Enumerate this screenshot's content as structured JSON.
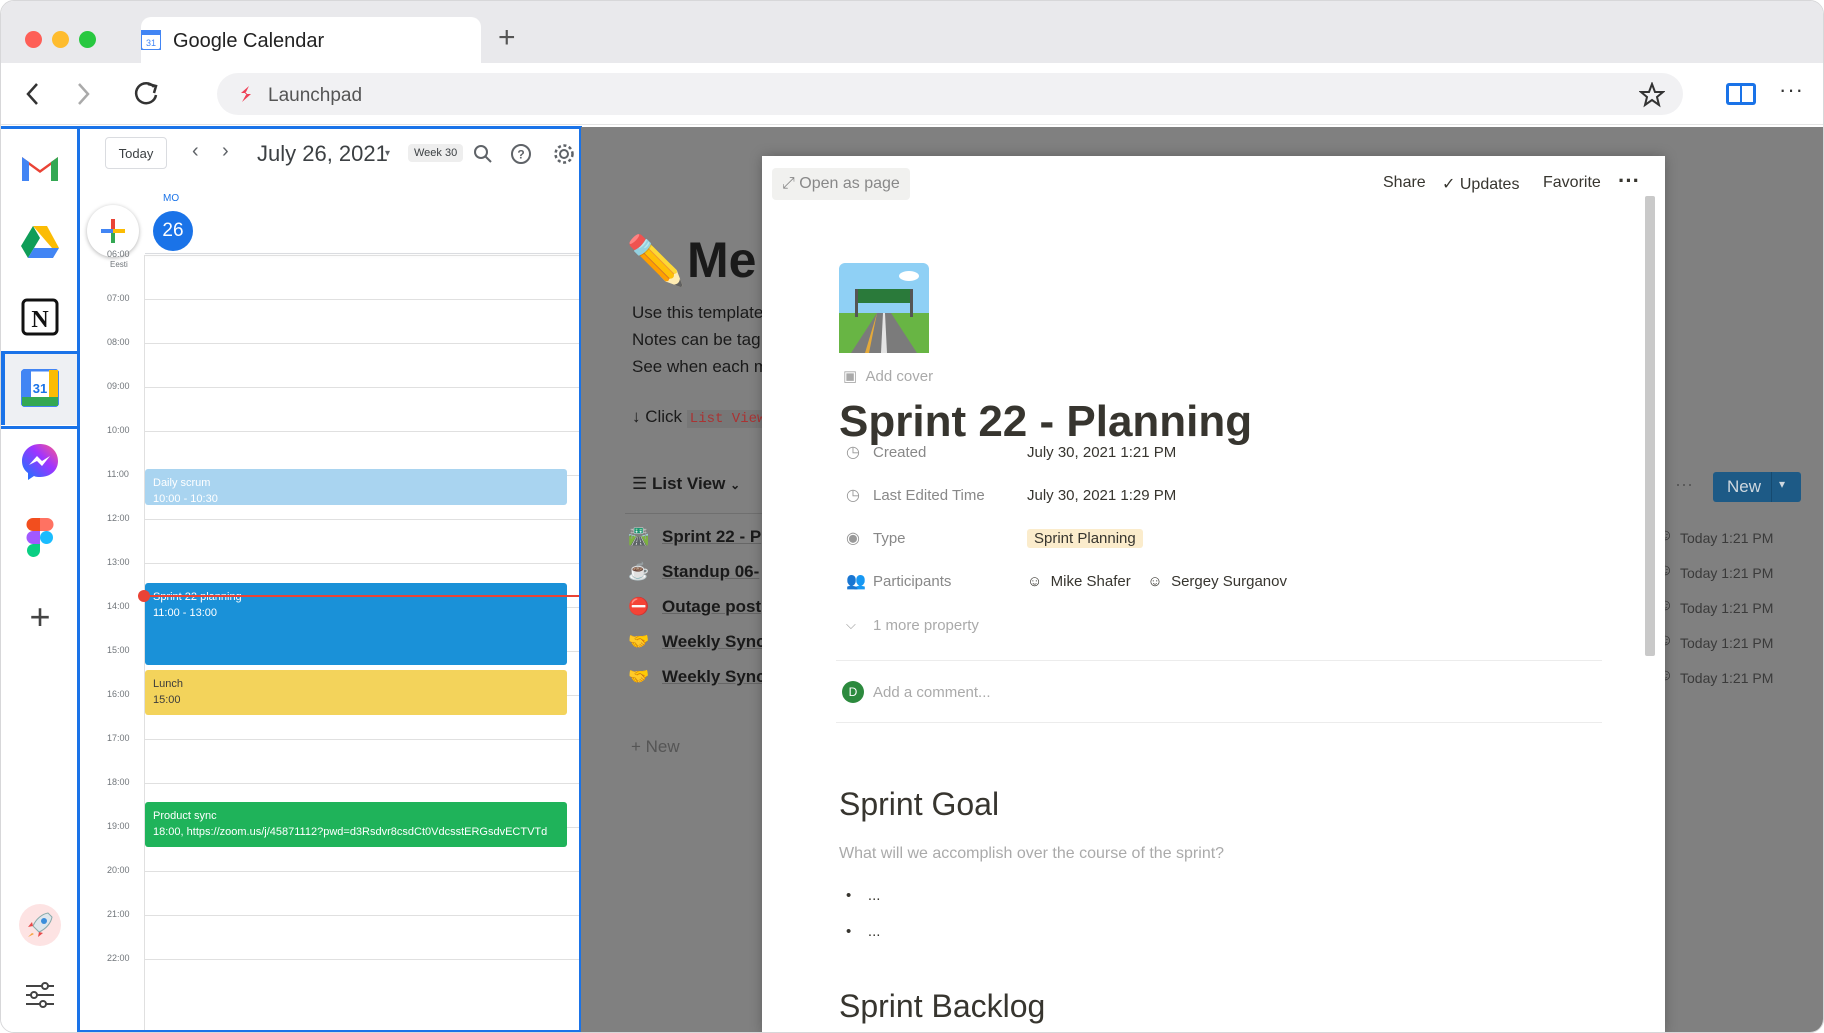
{
  "browser": {
    "tab_title": "Google Calendar",
    "url_text": "Launchpad"
  },
  "sidebar": {
    "apps": [
      "gmail-icon",
      "google-drive-icon",
      "notion-icon",
      "google-calendar-icon",
      "messenger-icon",
      "figma-icon"
    ],
    "add_label": "+"
  },
  "calendar": {
    "today_label": "Today",
    "date_label": "July  26, 2021",
    "week_label": "Week 30",
    "day_abbr": "MO",
    "day_number": "26",
    "timezone_label": "Eesti",
    "hours": [
      "06:00",
      "07:00",
      "08:00",
      "09:00",
      "10:00",
      "11:00",
      "12:00",
      "13:00",
      "14:00",
      "15:00",
      "16:00",
      "17:00",
      "18:00",
      "19:00",
      "20:00",
      "21:00",
      "22:00"
    ],
    "events": [
      {
        "title": "Daily scrum",
        "time": "10:00 - 10:30",
        "color": "#a9d4f0",
        "text_color": "#ffffff"
      },
      {
        "title": "Sprint 22 planning",
        "time": "11:00 - 13:00",
        "color": "#1a91d8",
        "text_color": "#ffffff"
      },
      {
        "title": "Lunch",
        "time": "15:00",
        "color": "#f3d35b",
        "text_color": "#3c3c3c"
      },
      {
        "title": "Product sync",
        "time": "18:00, https://zoom.us/j/45871112?pwd=d3Rsdvr8csdCt0VdcsstERGsdvECTVTd",
        "color": "#1fb35a",
        "text_color": "#ffffff"
      }
    ]
  },
  "notion_background": {
    "title_fragment": "Me",
    "desc_lines": [
      "Use this template",
      "Notes can be tag",
      "See when each m"
    ],
    "click_text": "↓ Click",
    "code_text": "List View",
    "view_label": "List View",
    "new_button": "New",
    "rows": [
      {
        "icon": "🛣️",
        "title": "Sprint 22 - P",
        "time": "Today 1:21 PM"
      },
      {
        "icon": "☕",
        "title": "Standup 06-",
        "time": "Today 1:21 PM"
      },
      {
        "icon": "⛔",
        "title": "Outage post",
        "time": "Today 1:21 PM"
      },
      {
        "icon": "🤝",
        "title": "Weekly Sync",
        "time": "Today 1:21 PM"
      },
      {
        "icon": "🤝",
        "title": "Weekly Sync",
        "time": "Today 1:21 PM"
      }
    ],
    "new_row_label": "New"
  },
  "peek": {
    "open_as_page": "Open as page",
    "share": "Share",
    "updates": "Updates",
    "favorite": "Favorite",
    "add_cover": "Add cover",
    "title": "Sprint 22 - Planning",
    "properties": [
      {
        "name": "Created",
        "value": "July 30, 2021 1:21 PM",
        "icon": "clock-icon"
      },
      {
        "name": "Last Edited Time",
        "value": "July 30, 2021 1:29 PM",
        "icon": "clock-icon"
      },
      {
        "name": "Type",
        "value": "Sprint Planning",
        "icon": "select-icon"
      },
      {
        "name": "Participants",
        "value": "",
        "icon": "people-icon"
      }
    ],
    "participants": [
      "Mike Shafer",
      "Sergey Surganov"
    ],
    "more_property": "1 more property",
    "comment_avatar": "D",
    "comment_placeholder": "Add a comment...",
    "heading_goal": "Sprint Goal",
    "goal_prompt": "What will we accomplish over the course of the sprint?",
    "bullets": [
      "...",
      "..."
    ],
    "heading_backlog": "Sprint Backlog"
  }
}
